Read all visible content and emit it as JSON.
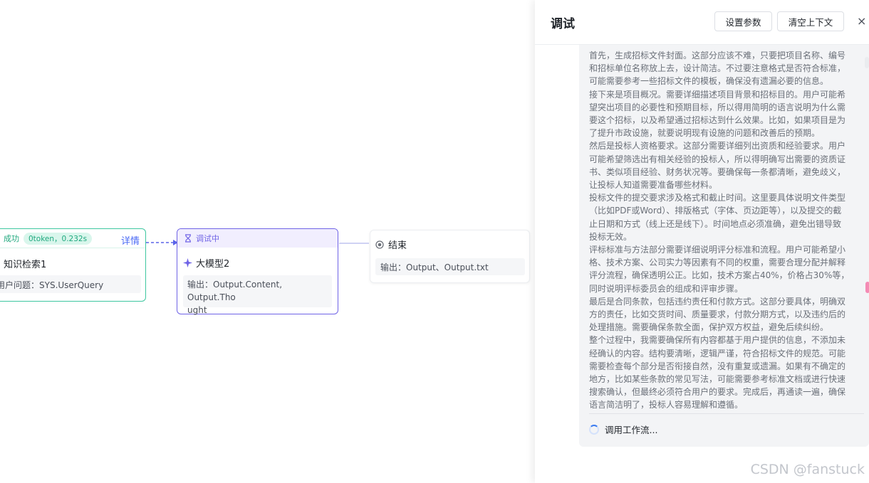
{
  "canvas": {
    "node1": {
      "status": "成功",
      "badge": "0token，0.232s",
      "detail": "详情",
      "title": "知识检索1",
      "io": "用户问题：SYS.UserQuery"
    },
    "node2": {
      "status": "调试中",
      "title": "大模型2",
      "io_line1": "输出：Output.Content, Output.Tho",
      "io_line2": "ught"
    },
    "node3": {
      "title": "结束",
      "io": "输出：Output、Output.txt"
    }
  },
  "panel": {
    "title": "调试",
    "settings_button": "设置参数",
    "clear_button": "清空上下文",
    "close_icon": "×",
    "message_lines": [
      "首先，生成招标文件封面。这部分应该不难，只要把项目名称、编号",
      "和招标单位名称放上去，设计简洁。不过要注意格式是否符合标准，",
      "可能需要参考一些招标文件的模板，确保没有遗漏必要的信息。",
      "接下来是项目概况。需要详细描述项目背景和招标目的。用户可能希",
      "望突出项目的必要性和预期目标，所以得用简明的语言说明为什么需",
      "要这个招标，以及希望通过招标达到什么效果。比如，如果项目是为",
      "了提升市政设施，就要说明现有设施的问题和改善后的预期。",
      "然后是投标人资格要求。这部分需要详细列出资质和经验要求。用户",
      "可能希望筛选出有相关经验的投标人，所以得明确写出需要的资质证",
      "书、类似项目经验、财务状况等。要确保每一条都清晰，避免歧义，",
      "让投标人知道需要准备哪些材料。",
      "投标文件的提交要求涉及格式和截止时间。这里要具体说明文件类型",
      "（比如PDF或Word）、排版格式（字体、页边距等），以及提交的截",
      "止日期和方式（线上还是线下）。时间地点必须准确，避免出错导致",
      "投标无效。",
      "评标标准与方法部分需要详细说明评分标准和流程。用户可能希望小",
      "格、技术方案、公司实力等因素有不同的权重，需要合理分配并解释",
      "评分流程，确保透明公正。比如，技术方案占40%，价格占30%等，",
      "同时说明评标委员会的组成和评审步骤。",
      "最后是合同条款，包括违约责任和付款方式。这部分要具体，明确双",
      "方的责任，比如交货时间、质量要求，付款分期方式，以及违约后的",
      "处理措施。需要确保条款全面，保护双方权益，避免后续纠纷。",
      "整个过程中，我需要确保所有内容都基于用户提供的信息，不添加未",
      "经确认的内容。结构要清晰，逻辑严谨，符合招标文件的规范。可能",
      "需要检查每个部分是否衔接自然，没有重复或遗漏。如果有不确定的",
      "地方，比如某些条款的常见写法，可能需要参考标准文档或进行快速",
      "搜索确认，但最终必须符合用户的要求。完成后，再通读一遍，确保",
      "语言简洁明了，投标人容易理解和遵循。"
    ],
    "status_text": "调用工作流..."
  },
  "watermark": "CSDN @fanstuck"
}
